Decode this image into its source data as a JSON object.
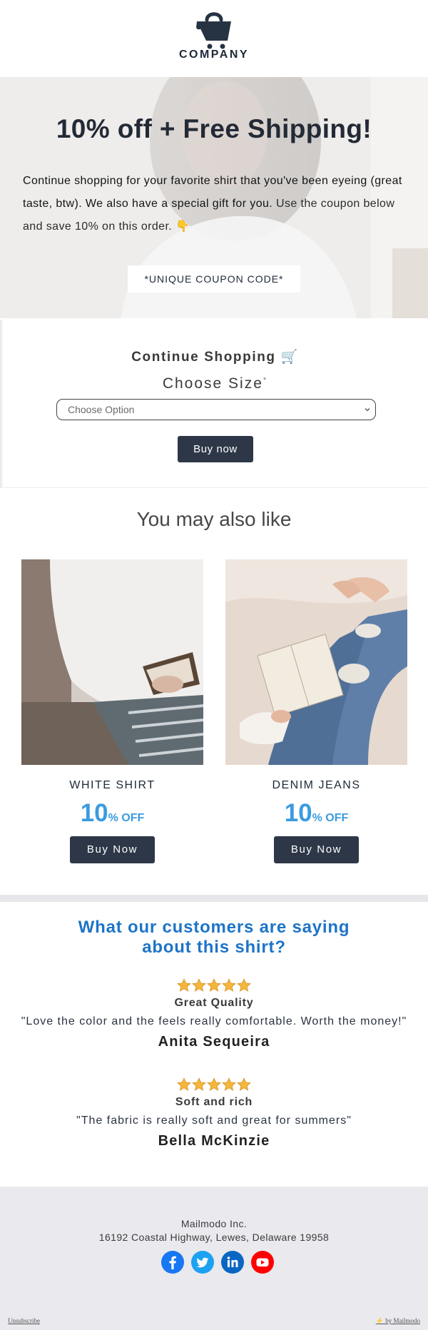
{
  "header": {
    "company": "COMPANY",
    "logo_icon": "shopping-basket-icon"
  },
  "hero": {
    "title": "10% off + Free Shipping!",
    "text_main": "Continue shopping for your favorite shirt that you've been eyeing (great taste, btw). We also have a special gift for you.",
    "text_light": " Use the coupon below and save 10% on this order. ",
    "emoji": "👇",
    "coupon": "*UNIQUE COUPON CODE*"
  },
  "shop": {
    "title": "Continue Shopping 🛒",
    "size_label": "Choose Size",
    "required_mark": "*",
    "select_value": "Choose Option",
    "buy_label": "Buy now"
  },
  "also_like": {
    "title": "You may also like",
    "products": [
      {
        "name": "WHITE SHIRT",
        "discount_number": "10",
        "discount_text": "% OFF",
        "button": "Buy Now"
      },
      {
        "name": "DENIM JEANS",
        "discount_number": "10",
        "discount_text": "% OFF",
        "button": "Buy Now"
      }
    ]
  },
  "reviews": {
    "title_line1": "What our customers are saying",
    "title_line2": "about this shirt?",
    "items": [
      {
        "stars": 5,
        "title": "Great Quality",
        "quote": "\"Love the color and the feels really comfortable. Worth the money!\"",
        "author": "Anita Sequeira"
      },
      {
        "stars": 5,
        "title": "Soft and rich",
        "quote": "\"The fabric is really soft and great for summers\"",
        "author": "Bella McKinzie"
      }
    ]
  },
  "footer": {
    "company": "Mailmodo Inc.",
    "address": "16192 Coastal Highway, Lewes, Delaware 19958",
    "social_icons": [
      "facebook-icon",
      "twitter-icon",
      "linkedin-icon",
      "youtube-icon"
    ],
    "unsubscribe": "Unsubscribe",
    "powered_by": "⚡ by Mailmodo"
  },
  "colors": {
    "dark_button": "#2d3748",
    "discount_blue": "#3b9be0",
    "review_title_blue": "#1e74c7",
    "star_gold": "#f4b73a",
    "footer_bg": "#e9e9ee"
  }
}
